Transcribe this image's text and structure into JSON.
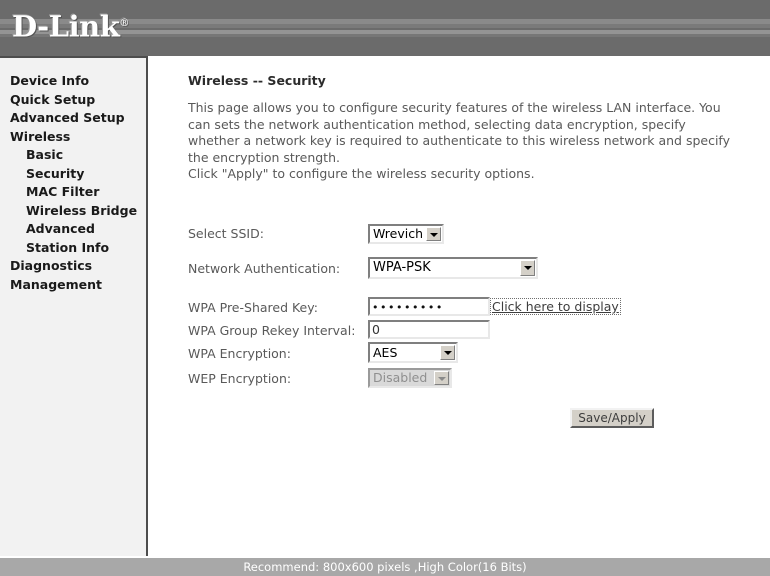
{
  "header": {
    "logo_text": "D-Link",
    "logo_reg_mark": "®"
  },
  "sidebar": {
    "items": [
      {
        "label": "Device Info",
        "level": 0
      },
      {
        "label": "Quick Setup",
        "level": 0
      },
      {
        "label": "Advanced Setup",
        "level": 0
      },
      {
        "label": "Wireless",
        "level": 0
      },
      {
        "label": "Basic",
        "level": 1
      },
      {
        "label": "Security",
        "level": 1
      },
      {
        "label": "MAC Filter",
        "level": 1
      },
      {
        "label": "Wireless Bridge",
        "level": 1
      },
      {
        "label": "Advanced",
        "level": 1
      },
      {
        "label": "Station Info",
        "level": 1
      },
      {
        "label": "Diagnostics",
        "level": 0
      },
      {
        "label": "Management",
        "level": 0
      }
    ]
  },
  "main": {
    "title": "Wireless -- Security",
    "description": "This page allows you to configure security features of the wireless LAN interface. You can sets the network authentication method, selecting data encryption, specify whether a network key is required to authenticate to this wireless network and specify the encryption strength.\nClick \"Apply\" to configure the wireless security options.",
    "form": {
      "select_ssid": {
        "label": "Select SSID:",
        "value": "Wrevich",
        "options": [
          "Wrevich"
        ]
      },
      "network_authentication": {
        "label": "Network Authentication:",
        "value": "WPA-PSK",
        "options": [
          "WPA-PSK"
        ]
      },
      "wpa_pre_shared_key": {
        "label": "WPA Pre-Shared Key:",
        "value": "•••••••••",
        "masked": true
      },
      "display_link": {
        "label": "Click here to display"
      },
      "wpa_group_rekey_interval": {
        "label": "WPA Group Rekey Interval:",
        "value": "0"
      },
      "wpa_encryption": {
        "label": "WPA Encryption:",
        "value": "AES",
        "options": [
          "AES"
        ]
      },
      "wep_encryption": {
        "label": "WEP Encryption:",
        "value": "Disabled",
        "options": [
          "Disabled"
        ],
        "disabled": true
      },
      "save_button": {
        "label": "Save/Apply"
      }
    }
  },
  "footer": {
    "text": "Recommend: 800x600 pixels ,High Color(16 Bits)"
  }
}
